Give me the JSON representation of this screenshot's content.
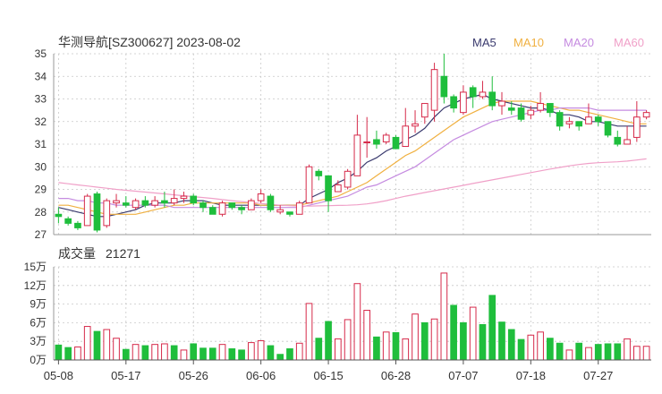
{
  "header": {
    "title": "华测导航[SZ300627] 2023-08-02",
    "volume_title": "成交量",
    "volume_value": "21271"
  },
  "legend": [
    {
      "label": "MA5",
      "color": "#3a3a6e"
    },
    {
      "label": "MA10",
      "color": "#f0b040"
    },
    {
      "label": "MA20",
      "color": "#c58be0"
    },
    {
      "label": "MA60",
      "color": "#f0a0c8"
    }
  ],
  "colors": {
    "up": "#d62a4a",
    "down": "#1fbe3c",
    "grid": "#c8c8c8",
    "axis": "#999999"
  },
  "chart_data": [
    {
      "type": "candlestick",
      "ylim": [
        27,
        35
      ],
      "y_ticks": [
        "27",
        "28",
        "29",
        "30",
        "31",
        "32",
        "33",
        "34",
        "35"
      ],
      "x_tick_labels": [
        "05-08",
        "05-17",
        "05-26",
        "06-06",
        "06-15",
        "06-28",
        "07-07",
        "07-18",
        "07-27"
      ],
      "x_tick_index": [
        0,
        7,
        14,
        21,
        28,
        35,
        42,
        49,
        56
      ],
      "candles": [
        [
          27.9,
          27.8,
          28.2,
          27.5
        ],
        [
          27.7,
          27.5,
          27.8,
          27.4
        ],
        [
          27.5,
          27.3,
          27.6,
          27.2
        ],
        [
          27.4,
          28.7,
          28.8,
          27.4
        ],
        [
          28.8,
          27.2,
          28.9,
          27.1
        ],
        [
          27.4,
          28.5,
          28.6,
          27.3
        ],
        [
          28.4,
          28.5,
          28.8,
          28.2
        ],
        [
          28.4,
          28.3,
          28.7,
          28.2
        ],
        [
          28.2,
          28.5,
          28.6,
          28.1
        ],
        [
          28.5,
          28.3,
          28.7,
          28.2
        ],
        [
          28.3,
          28.5,
          28.7,
          28.2
        ],
        [
          28.5,
          28.4,
          28.9,
          28.2
        ],
        [
          28.4,
          28.6,
          29.0,
          28.3
        ],
        [
          28.6,
          28.7,
          28.9,
          28.4
        ],
        [
          28.7,
          28.4,
          28.8,
          28.3
        ],
        [
          28.4,
          28.2,
          28.5,
          28.0
        ],
        [
          28.2,
          27.9,
          28.3,
          27.9
        ],
        [
          27.9,
          28.4,
          28.5,
          27.8
        ],
        [
          28.4,
          28.2,
          28.4,
          28.1
        ],
        [
          28.2,
          28.1,
          28.3,
          27.9
        ],
        [
          28.1,
          28.5,
          28.6,
          28.1
        ],
        [
          28.5,
          28.8,
          29.0,
          28.4
        ],
        [
          28.7,
          28.1,
          28.8,
          28.0
        ],
        [
          28.0,
          28.1,
          28.3,
          27.9
        ],
        [
          28.0,
          27.9,
          28.0,
          27.8
        ],
        [
          27.9,
          28.4,
          28.5,
          27.9
        ],
        [
          28.4,
          30.0,
          30.1,
          28.4
        ],
        [
          29.8,
          29.6,
          29.9,
          29.4
        ],
        [
          29.6,
          28.5,
          29.6,
          28.0
        ],
        [
          28.9,
          29.2,
          29.4,
          28.9
        ],
        [
          29.1,
          29.8,
          29.9,
          29.0
        ],
        [
          29.6,
          31.4,
          32.3,
          29.6
        ],
        [
          31.1,
          31.1,
          32.2,
          30.4
        ],
        [
          31.2,
          31.0,
          31.6,
          30.8
        ],
        [
          31.1,
          31.4,
          31.5,
          31.0
        ],
        [
          31.3,
          30.8,
          31.4,
          30.8
        ],
        [
          30.9,
          31.8,
          32.6,
          30.9
        ],
        [
          31.8,
          31.9,
          32.5,
          31.5
        ],
        [
          32.2,
          32.8,
          32.5,
          31.9
        ],
        [
          32.5,
          34.3,
          34.6,
          32.0
        ],
        [
          34.0,
          33.1,
          35.0,
          32.8
        ],
        [
          33.1,
          32.6,
          33.2,
          32.4
        ],
        [
          32.4,
          33.3,
          33.6,
          32.3
        ],
        [
          33.5,
          33.1,
          33.6,
          32.6
        ],
        [
          33.1,
          33.3,
          33.8,
          33.0
        ],
        [
          33.3,
          32.7,
          34.0,
          32.5
        ],
        [
          32.7,
          32.9,
          33.3,
          32.3
        ],
        [
          32.6,
          32.5,
          32.9,
          32.3
        ],
        [
          32.6,
          32.1,
          32.8,
          32.0
        ],
        [
          32.3,
          32.5,
          32.7,
          32.1
        ],
        [
          32.5,
          32.8,
          33.3,
          32.4
        ],
        [
          32.8,
          32.4,
          32.8,
          32.2
        ],
        [
          32.4,
          31.8,
          32.5,
          31.6
        ],
        [
          31.9,
          32.0,
          32.2,
          31.7
        ],
        [
          32.0,
          31.8,
          32.0,
          31.6
        ],
        [
          31.9,
          32.2,
          32.8,
          31.9
        ],
        [
          32.2,
          32.0,
          32.3,
          31.8
        ],
        [
          32.0,
          31.4,
          32.0,
          31.3
        ],
        [
          31.3,
          31.0,
          31.6,
          30.9
        ],
        [
          31.0,
          31.2,
          31.8,
          31.0
        ],
        [
          31.3,
          32.2,
          32.9,
          31.1
        ],
        [
          32.2,
          32.4,
          32.5,
          32.1
        ]
      ],
      "series": [
        {
          "name": "MA5",
          "values": [
            28.2,
            28.1,
            28.0,
            27.9,
            27.8,
            27.8,
            27.9,
            28.0,
            28.1,
            28.3,
            28.4,
            28.4,
            28.4,
            28.5,
            28.5,
            28.5,
            28.4,
            28.3,
            28.3,
            28.3,
            28.3,
            28.3,
            28.3,
            28.3,
            28.3,
            28.3,
            28.6,
            28.8,
            29.0,
            29.3,
            29.5,
            29.8,
            30.2,
            30.4,
            30.7,
            30.9,
            31.2,
            31.4,
            31.7,
            32.2,
            32.6,
            32.8,
            33.0,
            33.1,
            33.2,
            33.0,
            32.9,
            32.8,
            32.7,
            32.6,
            32.6,
            32.5,
            32.3,
            32.3,
            32.2,
            32.0,
            32.0,
            31.9,
            31.8,
            31.8,
            31.8,
            31.8
          ]
        },
        {
          "name": "MA10",
          "values": [
            28.3,
            28.3,
            28.2,
            28.1,
            28.0,
            27.9,
            27.9,
            27.9,
            27.9,
            28.0,
            28.1,
            28.2,
            28.3,
            28.3,
            28.4,
            28.4,
            28.4,
            28.4,
            28.4,
            28.4,
            28.4,
            28.3,
            28.3,
            28.3,
            28.3,
            28.3,
            28.4,
            28.5,
            28.6,
            28.7,
            28.9,
            29.1,
            29.3,
            29.6,
            29.9,
            30.2,
            30.5,
            30.7,
            31.0,
            31.3,
            31.6,
            31.9,
            32.2,
            32.4,
            32.6,
            32.8,
            32.9,
            32.9,
            32.9,
            32.9,
            32.8,
            32.7,
            32.6,
            32.5,
            32.5,
            32.4,
            32.3,
            32.2,
            32.1,
            32.0,
            31.9,
            31.9
          ]
        },
        {
          "name": "MA20",
          "values": [
            28.6,
            28.6,
            28.5,
            28.5,
            28.4,
            28.4,
            28.3,
            28.3,
            28.3,
            28.3,
            28.3,
            28.3,
            28.2,
            28.2,
            28.2,
            28.2,
            28.2,
            28.2,
            28.2,
            28.2,
            28.2,
            28.2,
            28.2,
            28.2,
            28.2,
            28.2,
            28.3,
            28.4,
            28.5,
            28.6,
            28.7,
            28.9,
            29.1,
            29.2,
            29.4,
            29.6,
            29.8,
            30.0,
            30.3,
            30.6,
            30.9,
            31.2,
            31.4,
            31.6,
            31.8,
            32.0,
            32.1,
            32.2,
            32.3,
            32.4,
            32.5,
            32.5,
            32.6,
            32.6,
            32.6,
            32.6,
            32.5,
            32.5,
            32.5,
            32.5,
            32.5,
            32.5
          ]
        },
        {
          "name": "MA60",
          "values": [
            29.3,
            29.25,
            29.2,
            29.15,
            29.1,
            29.05,
            29.0,
            28.96,
            28.92,
            28.88,
            28.84,
            28.8,
            28.76,
            28.72,
            28.68,
            28.64,
            28.6,
            28.55,
            28.5,
            28.46,
            28.42,
            28.38,
            28.34,
            28.3,
            28.28,
            28.26,
            28.26,
            28.27,
            28.28,
            28.29,
            28.3,
            28.32,
            28.36,
            28.42,
            28.5,
            28.6,
            28.7,
            28.78,
            28.86,
            28.94,
            29.02,
            29.1,
            29.18,
            29.26,
            29.34,
            29.42,
            29.5,
            29.58,
            29.66,
            29.74,
            29.82,
            29.9,
            29.97,
            30.04,
            30.1,
            30.15,
            30.18,
            30.2,
            30.22,
            30.25,
            30.3,
            30.35
          ]
        }
      ]
    },
    {
      "type": "bar",
      "title": "成交量",
      "ylim": [
        0,
        15
      ],
      "y_ticks": [
        "0万",
        "3万",
        "6万",
        "9万",
        "12万",
        "15万"
      ],
      "values": [
        2.4,
        2.0,
        2.1,
        5.4,
        4.6,
        4.9,
        3.5,
        1.7,
        2.5,
        2.3,
        2.5,
        2.6,
        2.3,
        1.6,
        2.6,
        1.9,
        1.9,
        2.5,
        1.8,
        1.6,
        2.8,
        3.1,
        2.3,
        0.9,
        1.8,
        2.7,
        9.1,
        3.5,
        6.2,
        3.4,
        6.5,
        12.3,
        8.0,
        3.7,
        4.5,
        4.4,
        3.4,
        7.4,
        6.0,
        6.6,
        14.0,
        8.8,
        6.0,
        8.5,
        5.7,
        10.4,
        6.1,
        4.9,
        3.3,
        4.0,
        4.5,
        3.5,
        2.7,
        1.6,
        2.7,
        2.0,
        2.5,
        2.6,
        2.6,
        3.4,
        2.2,
        2.2
      ],
      "directions": [
        "d",
        "d",
        "u",
        "u",
        "d",
        "u",
        "u",
        "d",
        "u",
        "d",
        "u",
        "u",
        "d",
        "u",
        "d",
        "d",
        "d",
        "u",
        "d",
        "d",
        "u",
        "u",
        "d",
        "d",
        "d",
        "u",
        "u",
        "d",
        "d",
        "u",
        "u",
        "u",
        "u",
        "d",
        "u",
        "d",
        "u",
        "u",
        "d",
        "u",
        "u",
        "d",
        "d",
        "u",
        "d",
        "d",
        "d",
        "d",
        "d",
        "u",
        "u",
        "d",
        "d",
        "u",
        "d",
        "u",
        "d",
        "d",
        "d",
        "u",
        "u",
        "u"
      ]
    }
  ]
}
